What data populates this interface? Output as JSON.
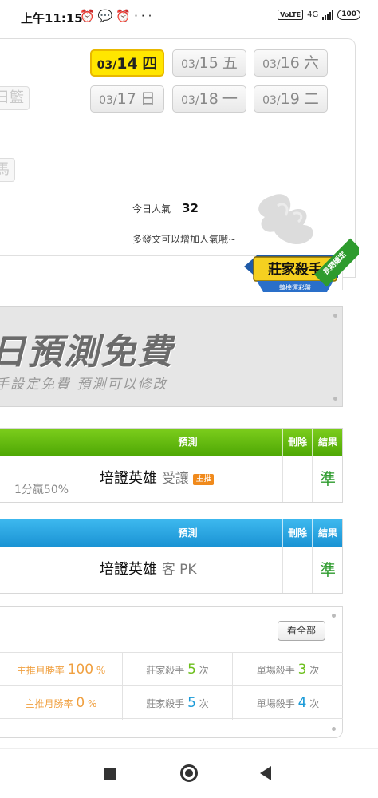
{
  "status_bar": {
    "time": "上午11:15",
    "icons": [
      "alarm-icon",
      "chat-icon",
      "alarm-icon",
      "more-icon"
    ],
    "more": "···",
    "volte": "VoLTE",
    "network": "4G",
    "battery": "100"
  },
  "left_buttons": {
    "a": "日籃",
    "b": "馬"
  },
  "dates": [
    {
      "md": "03/",
      "d": "14",
      "w": "四",
      "active": true
    },
    {
      "md": "03/",
      "d": "15",
      "w": "五",
      "active": false
    },
    {
      "md": "03/",
      "d": "16",
      "w": "六",
      "active": false
    },
    {
      "md": "03/",
      "d": "17",
      "w": "日",
      "active": false
    },
    {
      "md": "03/",
      "d": "18",
      "w": "一",
      "active": false
    },
    {
      "md": "03/",
      "d": "19",
      "w": "二",
      "active": false
    }
  ],
  "popularity": {
    "label": "今日人氣",
    "value": "32",
    "tip": "多發文可以增加人氣哦~"
  },
  "badge": {
    "title": "莊家殺手",
    "subtitle": "韓棒運彩盤",
    "ribbon": "長期穩定"
  },
  "promo": {
    "title": "日預測免費",
    "subtitle": "手設定免費 預測可以修改"
  },
  "table1": {
    "headers": {
      "predict": "預測",
      "delete": "刪除",
      "result": "結果"
    },
    "row": {
      "handicap": "1分贏50%",
      "team": "培證英雄",
      "side": "受讓",
      "tag": "主推",
      "result": "準"
    }
  },
  "table2": {
    "headers": {
      "predict": "預測",
      "delete": "刪除",
      "result": "結果"
    },
    "row": {
      "team": "培證英雄",
      "side": "客 PK",
      "result": "準"
    }
  },
  "stats": {
    "view_all": "看全部",
    "rows": [
      {
        "rate_label": "主推月勝率",
        "rate_value": "100",
        "rate_unit": "%",
        "killer_label": "莊家殺手",
        "killer_value": "5",
        "killer_unit": "次",
        "single_label": "單場殺手",
        "single_value": "3",
        "single_unit": "次"
      },
      {
        "rate_label": "主推月勝率",
        "rate_value": "0",
        "rate_unit": "%",
        "killer_label": "莊家殺手",
        "killer_value": "5",
        "killer_unit": "次",
        "single_label": "單場殺手",
        "single_value": "4",
        "single_unit": "次"
      }
    ]
  },
  "colors": {
    "active_date": "#ffe600",
    "green_header": "#5cb20d",
    "blue_header": "#2aa6e2",
    "result_green": "#2e9b2e",
    "rate_orange": "#f0a040"
  }
}
